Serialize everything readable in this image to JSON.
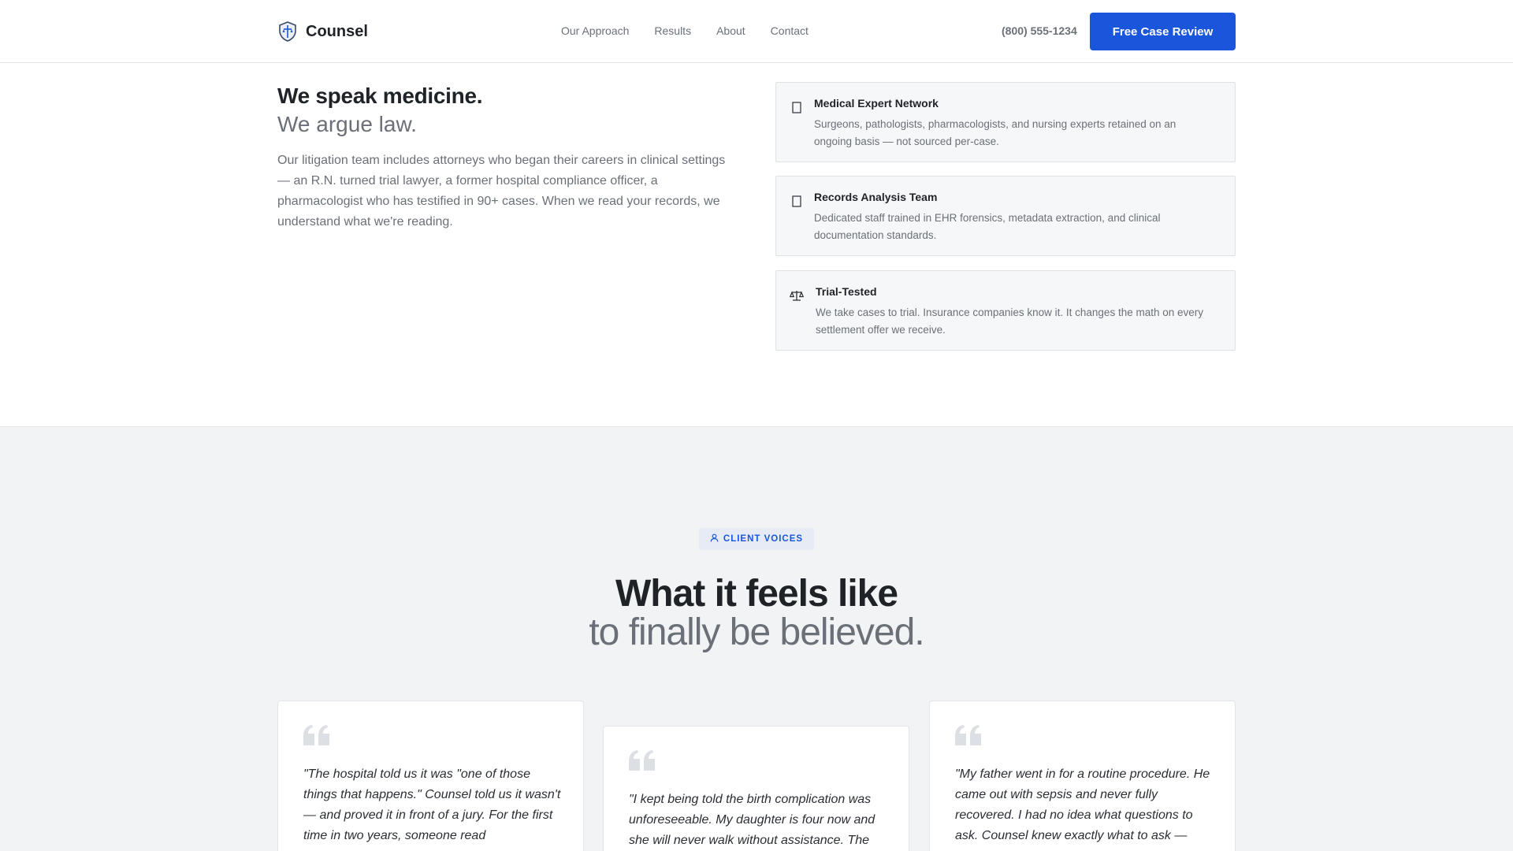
{
  "header": {
    "brand": "Counsel",
    "nav": [
      "Our Approach",
      "Results",
      "About",
      "Contact"
    ],
    "phone": "(800) 555-1234",
    "cta": "Free Case Review"
  },
  "intro": {
    "heading_strong": "We speak medicine.",
    "heading_light": "We argue law.",
    "paragraph": "Our litigation team includes attorneys who began their careers in clinical settings — an R.N. turned trial lawyer, a former hospital compliance officer, a pharmacologist who has testified in 90+ cases. When we read your records, we understand what we're reading."
  },
  "features": [
    {
      "icon": "document-icon",
      "title": "Medical Expert Network",
      "desc": "Surgeons, pathologists, pharmacologists, and nursing experts retained on an ongoing basis — not sourced per-case."
    },
    {
      "icon": "document-icon",
      "title": "Records Analysis Team",
      "desc": "Dedicated staff trained in EHR forensics, metadata extraction, and clinical documentation standards."
    },
    {
      "icon": "scales-icon",
      "title": "Trial-Tested",
      "desc": "We take cases to trial. Insurance companies know it. It changes the math on every settlement offer we receive."
    }
  ],
  "voices": {
    "badge": "CLIENT VOICES",
    "title_strong": "What it feels like",
    "title_light": "to finally be believed.",
    "testimonials": [
      {
        "quote": "\"The hospital told us it was \"one of those things that happens.\" Counsel told us it wasn't — and proved it in front of a jury. For the first time in two years, someone read"
      },
      {
        "quote": "\"I kept being told the birth complication was unforeseeable. My daughter is four now and she will never walk without assistance. The"
      },
      {
        "quote": "\"My father went in for a routine procedure. He came out with sepsis and never fully recovered. I had no idea what questions to ask. Counsel knew exactly what to ask —"
      }
    ]
  },
  "colors": {
    "accent": "#1a56db",
    "text_dark": "#1f2328",
    "text_muted": "#6b7078",
    "section_bg": "#f2f3f5"
  }
}
